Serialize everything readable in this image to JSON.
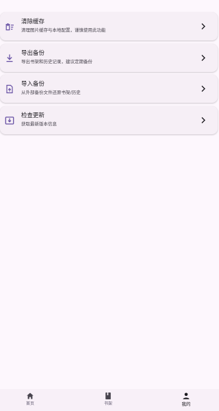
{
  "settings": {
    "items": [
      {
        "icon": "clear-cache-icon",
        "title": "清除缓存",
        "desc": "清理图片缓存与本地配置，谨慎使用此功能"
      },
      {
        "icon": "download-icon",
        "title": "导出备份",
        "desc": "导出书架和历史记录，建议定期备份"
      },
      {
        "icon": "upload-file-icon",
        "title": "导入备份",
        "desc": "从外部备份文件还原书架/历史"
      },
      {
        "icon": "system-update-icon",
        "title": "检查更新",
        "desc": "获取最新版本信息"
      }
    ]
  },
  "bottom_nav": {
    "home": "首页",
    "shelf": "书架",
    "mine": "我的",
    "active": "mine"
  },
  "colors": {
    "accent": "#6750a4",
    "background": "#fdf7fd",
    "card": "#f6eff6"
  }
}
